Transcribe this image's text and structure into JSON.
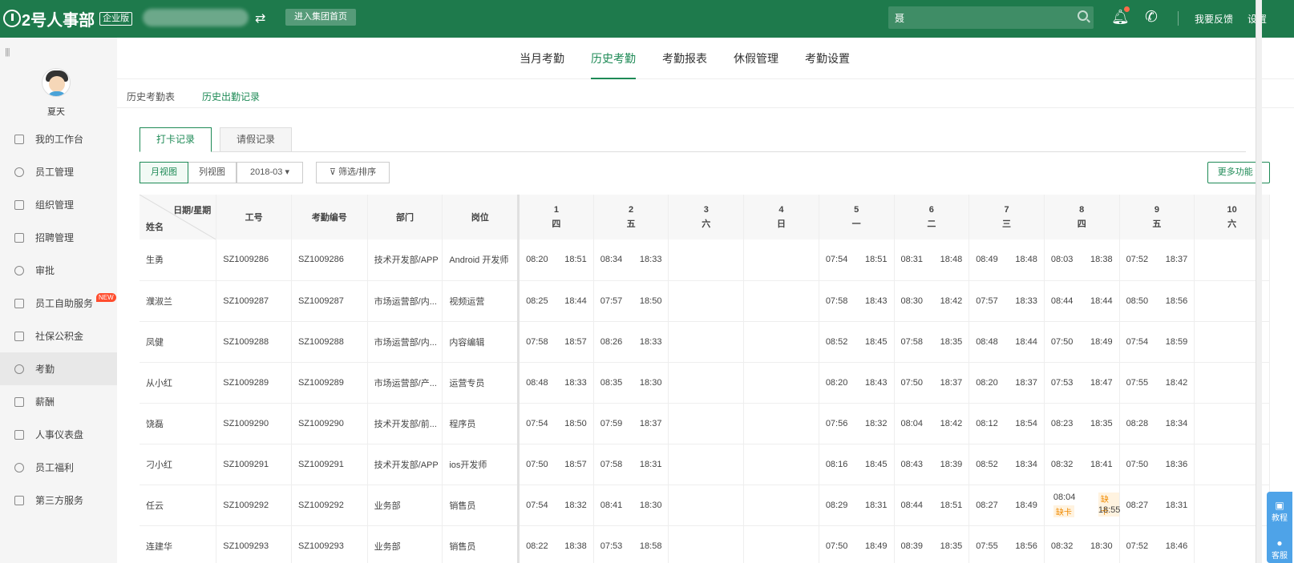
{
  "header": {
    "logo_text": "2号人事部",
    "edition": "企业版",
    "group_button": "进入集团首页",
    "search_value": "聂",
    "feedback": "我要反馈",
    "settings": "设置",
    "brand_color": "#1e7a4c"
  },
  "sidebar": {
    "user_name": "夏天",
    "items": [
      {
        "label": "我的工作台",
        "icon": "monitor-icon"
      },
      {
        "label": "员工管理",
        "icon": "person-icon"
      },
      {
        "label": "组织管理",
        "icon": "org-icon"
      },
      {
        "label": "招聘管理",
        "icon": "recruit-icon"
      },
      {
        "label": "审批",
        "icon": "approval-icon"
      },
      {
        "label": "员工自助服务",
        "icon": "phone-device-icon",
        "badge": "NEW"
      },
      {
        "label": "社保公积金",
        "icon": "house-icon"
      },
      {
        "label": "考勤",
        "icon": "calendar-icon",
        "active": true
      },
      {
        "label": "薪酬",
        "icon": "wallet-icon"
      },
      {
        "label": "人事仪表盘",
        "icon": "dashboard-icon"
      },
      {
        "label": "员工福利",
        "icon": "gift-icon"
      },
      {
        "label": "第三方服务",
        "icon": "grid-icon"
      }
    ]
  },
  "top_tabs": [
    "当月考勤",
    "历史考勤",
    "考勤报表",
    "休假管理",
    "考勤设置"
  ],
  "active_top_tab": "历史考勤",
  "sub_tabs": [
    "历史考勤表",
    "历史出勤记录"
  ],
  "active_sub_tab": "历史出勤记录",
  "inner_tabs": [
    "打卡记录",
    "请假记录"
  ],
  "toolbar": {
    "month_view": "月视图",
    "list_view": "列视图",
    "month": "2018-03",
    "filter": "筛选/排序",
    "more": "更多功能"
  },
  "table": {
    "corner_top": "日期/星期",
    "corner_bottom": "姓名",
    "columns": [
      "工号",
      "考勤编号",
      "部门",
      "岗位"
    ],
    "days": [
      {
        "num": "1",
        "wd": "四"
      },
      {
        "num": "2",
        "wd": "五"
      },
      {
        "num": "3",
        "wd": "六"
      },
      {
        "num": "4",
        "wd": "日"
      },
      {
        "num": "5",
        "wd": "一"
      },
      {
        "num": "6",
        "wd": "二"
      },
      {
        "num": "7",
        "wd": "三"
      },
      {
        "num": "8",
        "wd": "四"
      },
      {
        "num": "9",
        "wd": "五"
      },
      {
        "num": "10",
        "wd": "六"
      }
    ],
    "rows": [
      {
        "name": "生勇",
        "id": "SZ1009286",
        "code": "SZ1009286",
        "dept": "技术开发部/APP",
        "post": "Android 开发师",
        "days": [
          [
            "08:20",
            "18:51"
          ],
          [
            "08:34",
            "18:33"
          ],
          [],
          [],
          [
            "07:54",
            "18:51"
          ],
          [
            "08:31",
            "18:48"
          ],
          [
            "08:49",
            "18:48"
          ],
          [
            "08:03",
            "18:38"
          ],
          [
            "07:52",
            "18:37"
          ],
          []
        ]
      },
      {
        "name": "濮淑兰",
        "id": "SZ1009287",
        "code": "SZ1009287",
        "dept": "市场运营部/内...",
        "post": "视频运营",
        "days": [
          [
            "08:25",
            "18:44"
          ],
          [
            "07:57",
            "18:50"
          ],
          [],
          [],
          [
            "07:58",
            "18:43"
          ],
          [
            "08:30",
            "18:42"
          ],
          [
            "07:57",
            "18:33"
          ],
          [
            "08:44",
            "18:44"
          ],
          [
            "08:50",
            "18:56"
          ],
          []
        ]
      },
      {
        "name": "凤健",
        "id": "SZ1009288",
        "code": "SZ1009288",
        "dept": "市场运营部/内...",
        "post": "内容编辑",
        "days": [
          [
            "07:58",
            "18:57"
          ],
          [
            "08:26",
            "18:33"
          ],
          [],
          [],
          [
            "08:52",
            "18:45"
          ],
          [
            "07:58",
            "18:35"
          ],
          [
            "08:48",
            "18:44"
          ],
          [
            "07:50",
            "18:49"
          ],
          [
            "07:54",
            "18:59"
          ],
          []
        ]
      },
      {
        "name": "从小红",
        "id": "SZ1009289",
        "code": "SZ1009289",
        "dept": "市场运营部/产...",
        "post": "运营专员",
        "days": [
          [
            "08:48",
            "18:33"
          ],
          [
            "08:35",
            "18:30"
          ],
          [],
          [],
          [
            "08:20",
            "18:43"
          ],
          [
            "07:50",
            "18:37"
          ],
          [
            "08:20",
            "18:37"
          ],
          [
            "07:53",
            "18:47"
          ],
          [
            "07:55",
            "18:42"
          ],
          []
        ]
      },
      {
        "name": "饶磊",
        "id": "SZ1009290",
        "code": "SZ1009290",
        "dept": "技术开发部/前...",
        "post": "程序员",
        "days": [
          [
            "07:54",
            "18:50"
          ],
          [
            "07:59",
            "18:37"
          ],
          [],
          [],
          [
            "07:56",
            "18:32"
          ],
          [
            "08:04",
            "18:42"
          ],
          [
            "08:12",
            "18:54"
          ],
          [
            "08:23",
            "18:35"
          ],
          [
            "08:28",
            "18:34"
          ],
          []
        ]
      },
      {
        "name": "刁小红",
        "id": "SZ1009291",
        "code": "SZ1009291",
        "dept": "技术开发部/APP",
        "post": "ios开发师",
        "days": [
          [
            "07:50",
            "18:57"
          ],
          [
            "07:58",
            "18:31"
          ],
          [],
          [],
          [
            "08:16",
            "18:45"
          ],
          [
            "08:43",
            "18:39"
          ],
          [
            "08:52",
            "18:34"
          ],
          [
            "08:32",
            "18:41"
          ],
          [
            "07:50",
            "18:36"
          ],
          []
        ]
      },
      {
        "name": "任云",
        "id": "SZ1009292",
        "code": "SZ1009292",
        "dept": "业务部",
        "post": "销售员",
        "days": [
          [
            "07:54",
            "18:32"
          ],
          [
            "08:41",
            "18:30"
          ],
          [],
          [],
          [
            "08:29",
            "18:31"
          ],
          [
            "08:44",
            "18:51"
          ],
          [
            "08:27",
            "18:49"
          ],
          [
            "08:04",
            "缺卡",
            "缺卡",
            "18:55"
          ],
          [
            "08:27",
            "18:31"
          ],
          []
        ]
      },
      {
        "name": "连建华",
        "id": "SZ1009293",
        "code": "SZ1009293",
        "dept": "业务部",
        "post": "销售员",
        "days": [
          [
            "08:22",
            "18:38"
          ],
          [
            "07:53",
            "18:58"
          ],
          [],
          [],
          [
            "07:50",
            "18:49"
          ],
          [
            "08:39",
            "18:35"
          ],
          [
            "07:55",
            "18:56"
          ],
          [
            "08:32",
            "18:30"
          ],
          [
            "07:52",
            "18:46"
          ],
          []
        ]
      }
    ]
  },
  "float_help": [
    "教程",
    "客服"
  ]
}
